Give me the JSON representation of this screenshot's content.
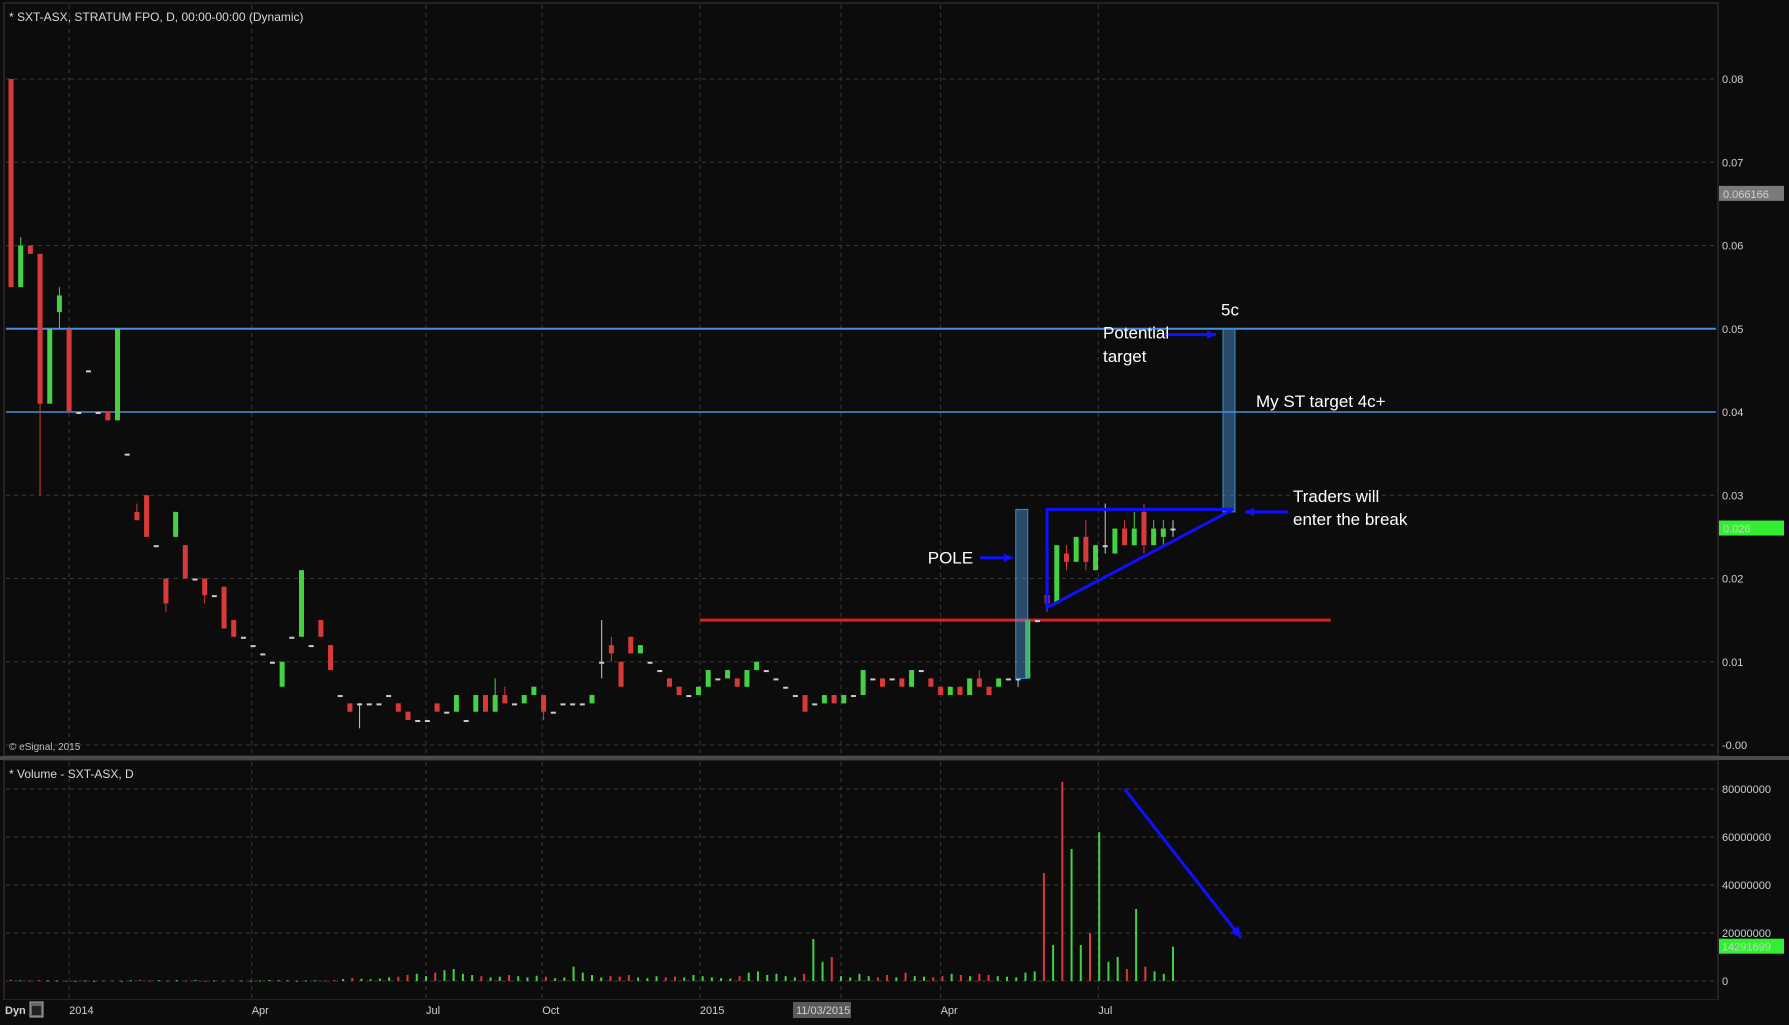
{
  "chart_data": [
    {
      "type": "candlestick",
      "title": "* SXT-ASX, STRATUM FPO, D, 00:00-00:00 (Dynamic)",
      "copyright": "© eSignal, 2015",
      "x_labels": [
        "2014",
        "Apr",
        "Jul",
        "Oct",
        "2015",
        "11/03/2015",
        "Apr",
        "Jul"
      ],
      "x_label_indices": [
        7,
        29,
        50,
        64,
        83,
        100,
        112,
        131
      ],
      "y_ticks": [
        "0.08",
        "0.07",
        "0.06",
        "0.05",
        "0.04",
        "0.03",
        "0.02",
        "0.01",
        "-0.00"
      ],
      "y_tick_values": [
        0.08,
        0.07,
        0.06,
        0.05,
        0.04,
        0.03,
        0.02,
        0.01,
        0.0
      ],
      "ylim": [
        -0.0005,
        0.0805
      ],
      "grid": true,
      "last_price_label": "0.026",
      "top_price_label": "0.066166",
      "top_price_value": 0.0662,
      "colors": {
        "background": "#0c0c0c",
        "up": "#44d144",
        "down": "#d83a3a",
        "flat": "#cccccc",
        "grid": "#3a3a3a",
        "hline": "#4a8fd8",
        "resistance": "#e02020",
        "annotation": "#1010ff",
        "price_box": "#33ee33"
      },
      "candles": [
        [
          0.08,
          0.08,
          0.055,
          0.055
        ],
        [
          0.055,
          0.061,
          0.055,
          0.06
        ],
        [
          0.06,
          0.06,
          0.059,
          0.059
        ],
        [
          0.059,
          0.059,
          0.03,
          0.041
        ],
        [
          0.041,
          0.05,
          0.041,
          0.05
        ],
        [
          0.052,
          0.055,
          0.05,
          0.054
        ],
        [
          0.05,
          0.05,
          0.04,
          0.04
        ],
        [
          0.04,
          0.04,
          0.04,
          0.04
        ],
        [
          0.045,
          0.045,
          0.045,
          0.045
        ],
        [
          0.04,
          0.04,
          0.04,
          0.04
        ],
        [
          0.04,
          0.04,
          0.039,
          0.039
        ],
        [
          0.039,
          0.05,
          0.039,
          0.05
        ],
        [
          0.035,
          0.035,
          0.035,
          0.035
        ],
        [
          0.028,
          0.029,
          0.027,
          0.027
        ],
        [
          0.03,
          0.03,
          0.025,
          0.025
        ],
        [
          0.024,
          0.024,
          0.024,
          0.024
        ],
        [
          0.02,
          0.02,
          0.016,
          0.017
        ],
        [
          0.025,
          0.028,
          0.025,
          0.028
        ],
        [
          0.024,
          0.024,
          0.02,
          0.02
        ],
        [
          0.02,
          0.02,
          0.02,
          0.02
        ],
        [
          0.02,
          0.02,
          0.017,
          0.018
        ],
        [
          0.018,
          0.018,
          0.018,
          0.018
        ],
        [
          0.019,
          0.019,
          0.014,
          0.014
        ],
        [
          0.015,
          0.015,
          0.013,
          0.013
        ],
        [
          0.013,
          0.013,
          0.013,
          0.013
        ],
        [
          0.012,
          0.012,
          0.012,
          0.012
        ],
        [
          0.011,
          0.011,
          0.011,
          0.011
        ],
        [
          0.01,
          0.01,
          0.01,
          0.01
        ],
        [
          0.007,
          0.01,
          0.007,
          0.01
        ],
        [
          0.013,
          0.013,
          0.013,
          0.013
        ],
        [
          0.013,
          0.021,
          0.013,
          0.021
        ],
        [
          0.012,
          0.012,
          0.012,
          0.012
        ],
        [
          0.015,
          0.015,
          0.013,
          0.013
        ],
        [
          0.012,
          0.012,
          0.009,
          0.009
        ],
        [
          0.006,
          0.006,
          0.006,
          0.006
        ],
        [
          0.005,
          0.005,
          0.004,
          0.004
        ],
        [
          0.005,
          0.005,
          0.002,
          0.005
        ],
        [
          0.005,
          0.005,
          0.005,
          0.005
        ],
        [
          0.005,
          0.005,
          0.005,
          0.005
        ],
        [
          0.006,
          0.006,
          0.006,
          0.006
        ],
        [
          0.005,
          0.005,
          0.004,
          0.004
        ],
        [
          0.004,
          0.004,
          0.003,
          0.003
        ],
        [
          0.003,
          0.003,
          0.003,
          0.003
        ],
        [
          0.003,
          0.003,
          0.003,
          0.003
        ],
        [
          0.005,
          0.005,
          0.004,
          0.004
        ],
        [
          0.004,
          0.004,
          0.004,
          0.004
        ],
        [
          0.004,
          0.006,
          0.004,
          0.006
        ],
        [
          0.003,
          0.003,
          0.003,
          0.003
        ],
        [
          0.004,
          0.006,
          0.004,
          0.006
        ],
        [
          0.006,
          0.006,
          0.004,
          0.004
        ],
        [
          0.004,
          0.008,
          0.004,
          0.006
        ],
        [
          0.006,
          0.007,
          0.005,
          0.005
        ],
        [
          0.005,
          0.005,
          0.005,
          0.005
        ],
        [
          0.005,
          0.006,
          0.005,
          0.006
        ],
        [
          0.006,
          0.007,
          0.006,
          0.007
        ],
        [
          0.006,
          0.006,
          0.003,
          0.004
        ],
        [
          0.004,
          0.004,
          0.004,
          0.004
        ],
        [
          0.005,
          0.005,
          0.005,
          0.005
        ],
        [
          0.005,
          0.005,
          0.005,
          0.005
        ],
        [
          0.005,
          0.005,
          0.005,
          0.005
        ],
        [
          0.005,
          0.006,
          0.005,
          0.006
        ],
        [
          0.01,
          0.015,
          0.008,
          0.01
        ],
        [
          0.012,
          0.013,
          0.01,
          0.011
        ],
        [
          0.01,
          0.01,
          0.007,
          0.007
        ],
        [
          0.013,
          0.013,
          0.011,
          0.011
        ],
        [
          0.011,
          0.012,
          0.011,
          0.012
        ],
        [
          0.01,
          0.01,
          0.01,
          0.01
        ],
        [
          0.009,
          0.009,
          0.009,
          0.009
        ],
        [
          0.008,
          0.008,
          0.007,
          0.007
        ],
        [
          0.007,
          0.007,
          0.006,
          0.006
        ],
        [
          0.006,
          0.006,
          0.006,
          0.006
        ],
        [
          0.006,
          0.007,
          0.006,
          0.007
        ],
        [
          0.007,
          0.009,
          0.007,
          0.009
        ],
        [
          0.008,
          0.008,
          0.008,
          0.008
        ],
        [
          0.008,
          0.009,
          0.008,
          0.009
        ],
        [
          0.008,
          0.008,
          0.007,
          0.007
        ],
        [
          0.007,
          0.009,
          0.007,
          0.009
        ],
        [
          0.009,
          0.01,
          0.009,
          0.01
        ],
        [
          0.009,
          0.009,
          0.009,
          0.009
        ],
        [
          0.008,
          0.008,
          0.008,
          0.008
        ],
        [
          0.007,
          0.007,
          0.007,
          0.007
        ],
        [
          0.006,
          0.006,
          0.006,
          0.006
        ],
        [
          0.006,
          0.006,
          0.004,
          0.004
        ],
        [
          0.005,
          0.005,
          0.005,
          0.005
        ],
        [
          0.005,
          0.006,
          0.005,
          0.006
        ],
        [
          0.006,
          0.006,
          0.005,
          0.005
        ],
        [
          0.005,
          0.006,
          0.005,
          0.006
        ],
        [
          0.006,
          0.006,
          0.006,
          0.006
        ],
        [
          0.006,
          0.009,
          0.006,
          0.009
        ],
        [
          0.008,
          0.008,
          0.008,
          0.008
        ],
        [
          0.008,
          0.008,
          0.007,
          0.007
        ],
        [
          0.008,
          0.008,
          0.008,
          0.008
        ],
        [
          0.008,
          0.008,
          0.007,
          0.007
        ],
        [
          0.007,
          0.009,
          0.007,
          0.009
        ],
        [
          0.009,
          0.009,
          0.009,
          0.009
        ],
        [
          0.008,
          0.008,
          0.007,
          0.007
        ],
        [
          0.007,
          0.007,
          0.006,
          0.006
        ],
        [
          0.006,
          0.007,
          0.006,
          0.007
        ],
        [
          0.007,
          0.007,
          0.006,
          0.006
        ],
        [
          0.006,
          0.008,
          0.006,
          0.008
        ],
        [
          0.008,
          0.009,
          0.007,
          0.007
        ],
        [
          0.007,
          0.007,
          0.006,
          0.006
        ],
        [
          0.007,
          0.008,
          0.007,
          0.008
        ],
        [
          0.008,
          0.008,
          0.008,
          0.008
        ],
        [
          0.008,
          0.008,
          0.007,
          0.008
        ],
        [
          0.008,
          0.015,
          0.008,
          0.015
        ],
        [
          0.015,
          0.015,
          0.015,
          0.015
        ],
        [
          0.018,
          0.018,
          0.016,
          0.017
        ],
        [
          0.017,
          0.024,
          0.017,
          0.024
        ],
        [
          0.023,
          0.024,
          0.021,
          0.022
        ],
        [
          0.022,
          0.025,
          0.022,
          0.025
        ],
        [
          0.025,
          0.027,
          0.021,
          0.022
        ],
        [
          0.021,
          0.024,
          0.021,
          0.024
        ],
        [
          0.024,
          0.029,
          0.023,
          0.024
        ],
        [
          0.023,
          0.026,
          0.023,
          0.026
        ],
        [
          0.026,
          0.027,
          0.024,
          0.024
        ],
        [
          0.024,
          0.028,
          0.024,
          0.026
        ],
        [
          0.028,
          0.029,
          0.023,
          0.024
        ],
        [
          0.024,
          0.027,
          0.024,
          0.026
        ],
        [
          0.025,
          0.027,
          0.024,
          0.026
        ],
        [
          0.026,
          0.027,
          0.025,
          0.026
        ]
      ]
    },
    {
      "type": "bar",
      "title": "* Volume - SXT-ASX, D",
      "y_ticks": [
        "80000000",
        "60000000",
        "40000000",
        "20000000",
        "0"
      ],
      "y_tick_values": [
        80000000,
        60000000,
        40000000,
        20000000,
        0
      ],
      "ylim": [
        0,
        88000000
      ],
      "last_volume_label": "14291699",
      "last_volume_value": 14291699,
      "volumes": [
        500000,
        300000,
        200000,
        400000,
        300000,
        200000,
        100000,
        100000,
        200000,
        100000,
        300000,
        200000,
        100000,
        300000,
        500000,
        200000,
        400000,
        100000,
        300000,
        200000,
        400000,
        100000,
        200000,
        100000,
        300000,
        200000,
        100000,
        200000,
        400000,
        300000,
        300000,
        100000,
        200000,
        300000,
        200000,
        400000,
        800000,
        1200000,
        900000,
        700000,
        1000000,
        1500000,
        1800000,
        2500000,
        3000000,
        2000000,
        3500000,
        4500000,
        5000000,
        3000000,
        2500000,
        2000000,
        1500000,
        1800000,
        2500000,
        2000000,
        1500000,
        2200000,
        1800000,
        1200000,
        1500000,
        6000000,
        3500000,
        2500000,
        1500000,
        2000000,
        1800000,
        2500000,
        1500000,
        1200000,
        2000000,
        1500000,
        1800000,
        1500000,
        2500000,
        2000000,
        1500000,
        1200000,
        1000000,
        2000000,
        3500000,
        4000000,
        2500000,
        3000000,
        2000000,
        1500000,
        3000000,
        17500000,
        8000000,
        10000000,
        2000000,
        1500000,
        3000000,
        2000000,
        1500000,
        2500000,
        1500000,
        3500000,
        2000000,
        1800000,
        1500000,
        2000000,
        3000000,
        2500000,
        2000000,
        3000000,
        2500000,
        2000000,
        1800000,
        1500000,
        3500000,
        4000000,
        45000000,
        15000000,
        83000000,
        55000000,
        15000000,
        20000000,
        62000000,
        8000000,
        10000000,
        5000000,
        30000000,
        6000000,
        4000000,
        3000000,
        14291699
      ]
    }
  ],
  "annotations": {
    "pole": "POLE",
    "potential": "Potential",
    "target": "target",
    "five_c": "5c",
    "st_target": "My ST target 4c+",
    "traders_1": "Traders will",
    "traders_2": "enter the break"
  },
  "levels": {
    "hline_high": 0.05,
    "hline_low": 0.04,
    "resistance": 0.015,
    "resistance_start_index": 83,
    "resistance_end_index": 159,
    "flag_top": 0.0283,
    "flag_apex": 0.028
  },
  "bottom_axis": {
    "mode_label": "Dyn",
    "icon": "calendar-icon"
  }
}
